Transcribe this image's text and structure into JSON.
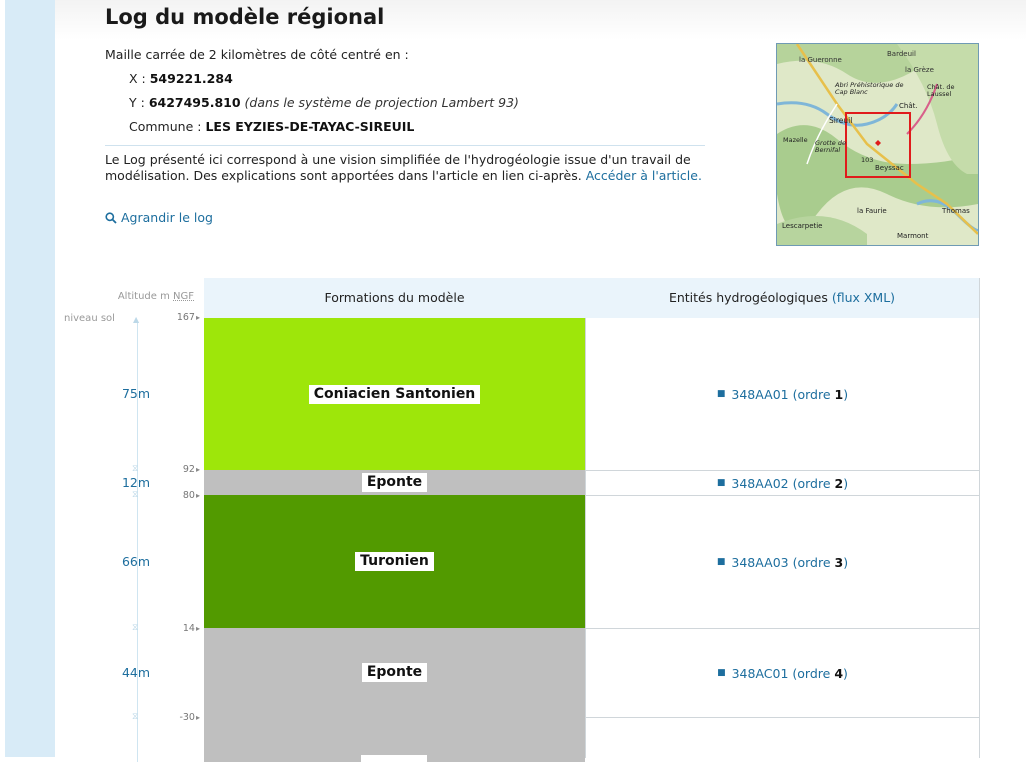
{
  "page": {
    "title": "Log du modèle régional",
    "maille": "Maille carrée de 2 kilomètres de côté centré en :",
    "x_label": "X :",
    "x_value": "549221.284",
    "y_label": "Y :",
    "y_value": "6427495.810",
    "y_note": "(dans le système de projection Lambert 93)",
    "commune_label": "Commune :",
    "commune_value": "LES EYZIES-DE-TAYAC-SIREUIL",
    "paragraph": "Le Log présenté ici correspond à une vision simplifiée de l'hydrogéologie issue d'un travail de modélisation. Des explications sont apportées dans l'article en lien ci-après.",
    "paragraph_link": "Accéder à l'article.",
    "agrandir": "Agrandir le log"
  },
  "map": {
    "labels": [
      "la Gueronne",
      "Bardeuil",
      "la Grèze",
      "Abri Préhistorique de Cap Blanc",
      "Chât. de Laussel",
      "Sireuil",
      "Chât.",
      "Grotte de Bernifal",
      "Beyssac",
      "103",
      "la Faurie",
      "Thomas",
      "Lescarpetie",
      "Marmont",
      "Mazelle"
    ],
    "accent": "#e01b1b"
  },
  "log": {
    "altitude_label": "Altitude m",
    "ngf": "NGF",
    "col_formations": "Formations du modèle",
    "col_entites": "Entités hydrogéologiques",
    "flux_xml": "(flux XML)",
    "niveau_sol": "niveau sol",
    "ticks": [
      "167",
      "92",
      "80",
      "14",
      "-30"
    ],
    "layers": [
      {
        "name": "Coniacien Santonien",
        "thickness": "75m",
        "color": "#9ee60a",
        "code": "348AA01",
        "ordre_label": "(ordre",
        "ordre": "1",
        "close": ")"
      },
      {
        "name": "Eponte",
        "thickness": "12m",
        "color": "#bfbfbf",
        "code": "348AA02",
        "ordre_label": "(ordre",
        "ordre": "2",
        "close": ")"
      },
      {
        "name": "Turonien",
        "thickness": "66m",
        "color": "#529a00",
        "code": "348AA03",
        "ordre_label": "(ordre",
        "ordre": "3",
        "close": ")"
      },
      {
        "name": "Eponte",
        "thickness": "44m",
        "color": "#bfbfbf",
        "code": "348AC01",
        "ordre_label": "(ordre",
        "ordre": "4",
        "close": ")"
      }
    ]
  }
}
